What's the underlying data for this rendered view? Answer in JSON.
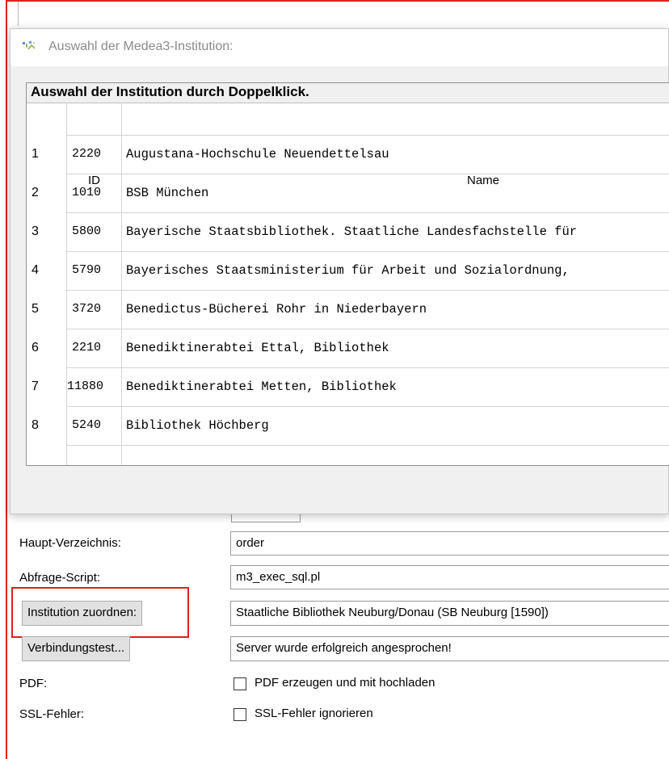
{
  "dialog": {
    "title": "Auswahl der Medea3-Institution:",
    "list_header": "Auswahl der Institution durch Doppelklick.",
    "columns": {
      "id": "ID",
      "name": "Name"
    },
    "rows": [
      {
        "num": "1",
        "id": "2220",
        "name": "Augustana-Hochschule Neuendettelsau"
      },
      {
        "num": "2",
        "id": "1010",
        "name": "BSB München"
      },
      {
        "num": "3",
        "id": "5800",
        "name": "Bayerische Staatsbibliothek. Staatliche Landesfachstelle für"
      },
      {
        "num": "4",
        "id": "5790",
        "name": "Bayerisches Staatsministerium für Arbeit und Sozialordnung,"
      },
      {
        "num": "5",
        "id": "3720",
        "name": "Benedictus-Bücherei Rohr in Niederbayern"
      },
      {
        "num": "6",
        "id": "2210",
        "name": "Benediktinerabtei Ettal, Bibliothek"
      },
      {
        "num": "7",
        "id": "11880",
        "name": "Benediktinerabtei Metten, Bibliothek"
      },
      {
        "num": "8",
        "id": "5240",
        "name": "Bibliothek Höchberg"
      }
    ]
  },
  "form": {
    "haupt_label": "Haupt-Verzeichnis:",
    "haupt_value": "order",
    "script_label": "Abfrage-Script:",
    "script_value": "m3_exec_sql.pl",
    "institution_button": "Institution zuordnen:",
    "institution_value": "Staatliche Bibliothek Neuburg/Donau (SB Neuburg [1590])",
    "test_button": "Verbindungstest...",
    "test_value": "Server wurde erfolgreich angesprochen!",
    "pdf_label": "PDF:",
    "pdf_checkbox_label": "PDF erzeugen und mit hochladen",
    "ssl_label": "SSL-Fehler:",
    "ssl_checkbox_label": "SSL-Fehler ignorieren"
  },
  "colors": {
    "highlight": "#e02020",
    "dialog_bg": "#f0f0f0"
  }
}
